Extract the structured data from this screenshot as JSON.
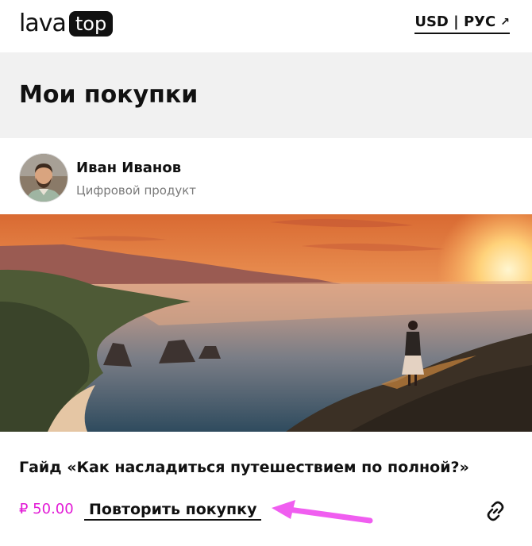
{
  "header": {
    "logo_text": "lava",
    "logo_badge": "top",
    "lang_label": "USD | РУС",
    "lang_arrow": "↗"
  },
  "page": {
    "title": "Мои покупки"
  },
  "seller": {
    "name": "Иван Иванов",
    "type": "Цифровой продукт"
  },
  "product": {
    "title": "Гайд «Как насладиться путешествием по полной?»",
    "price": "₽ 50.00",
    "repeat_label": "Повторить покупку",
    "link_icon": "link-icon"
  },
  "colors": {
    "price": "#e21bd6",
    "annotation_arrow": "#f05ef0",
    "title_band": "#f1f1f1"
  }
}
